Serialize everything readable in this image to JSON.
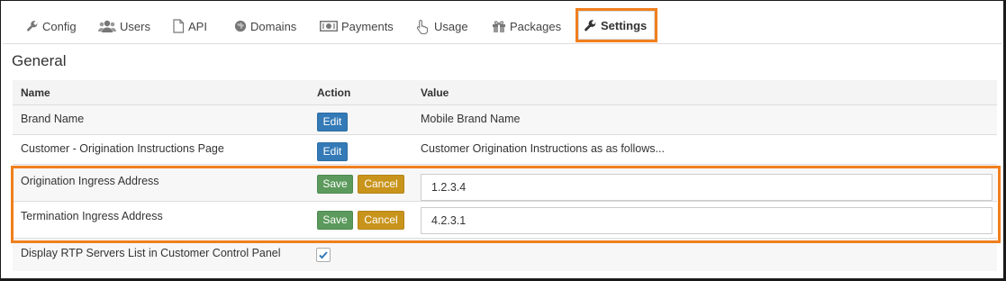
{
  "tabs": [
    {
      "label": "Config",
      "icon": "wrench-icon"
    },
    {
      "label": "Users",
      "icon": "users-icon"
    },
    {
      "label": "API",
      "icon": "file-icon"
    },
    {
      "label": "Domains",
      "icon": "globe-icon"
    },
    {
      "label": "Payments",
      "icon": "money-icon"
    },
    {
      "label": "Usage",
      "icon": "hand-pointer-icon"
    },
    {
      "label": "Packages",
      "icon": "gift-icon"
    },
    {
      "label": "Settings",
      "icon": "wrench-icon",
      "active": true
    }
  ],
  "section_title": "General",
  "table": {
    "headers": {
      "name": "Name",
      "action": "Action",
      "value": "Value"
    },
    "rows": [
      {
        "name": "Brand Name",
        "action": "Edit",
        "value": "Mobile Brand Name"
      },
      {
        "name": "Customer - Origination Instructions Page",
        "action": "Edit",
        "value": "Customer Origination Instructions as as follows..."
      },
      {
        "name": "Origination Ingress Address",
        "save": "Save",
        "cancel": "Cancel",
        "input_value": "1.2.3.4"
      },
      {
        "name": "Termination Ingress Address",
        "save": "Save",
        "cancel": "Cancel",
        "input_value": "4.2.3.1"
      },
      {
        "name": "Display RTP Servers List in Customer Control Panel",
        "checked": true
      }
    ]
  },
  "colors": {
    "highlight": "#f07f1d",
    "edit_button": "#337ab7",
    "save_button": "#5b9a5c",
    "cancel_button": "#c9941c"
  }
}
